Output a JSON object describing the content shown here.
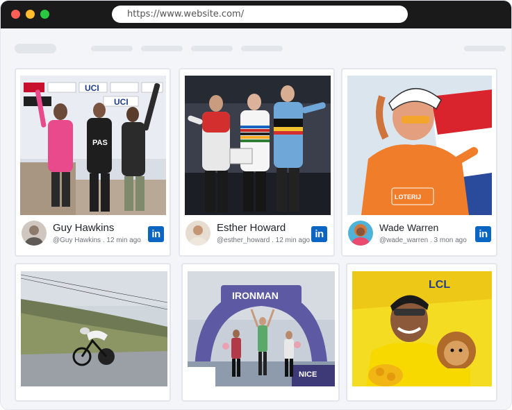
{
  "browser": {
    "url": "https://www.website.com/",
    "traffic_lights": {
      "close": "#ff5f57",
      "minimize": "#febc2e",
      "maximize": "#28c840"
    }
  },
  "theme": {
    "linkedin_blue": "#0a66c2",
    "page_bg": "#f3f5f9",
    "card_border": "#e3e6ec"
  },
  "posts": [
    {
      "name": "Guy Hawkins",
      "meta": "@Guy Hawkins . 12 min ago",
      "icon": "linkedin-icon"
    },
    {
      "name": "Esther Howard",
      "meta": "@esther_howard . 12 min ago",
      "icon": "linkedin-icon"
    },
    {
      "name": "Wade Warren",
      "meta": "@wade_warren . 3 mon ago",
      "icon": "linkedin-icon"
    }
  ],
  "photo_text": {
    "uci": "UCI",
    "pas": "PAS",
    "lotto": "LOTERIJ",
    "ironman": "IRONMAN",
    "nice": "NICE",
    "lcl": "LCL"
  },
  "linkedin_glyph": "in"
}
